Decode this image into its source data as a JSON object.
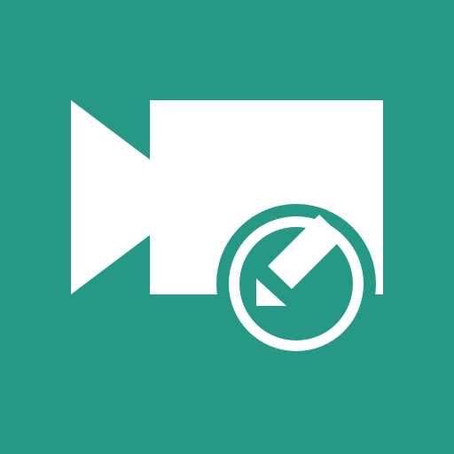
{
  "icon": {
    "name": "video-camera-edit-icon",
    "background_color": "#259985",
    "foreground_color": "#FFFFFF",
    "elements": [
      "video-camera-icon",
      "edit-badge",
      "pencil-icon"
    ]
  }
}
